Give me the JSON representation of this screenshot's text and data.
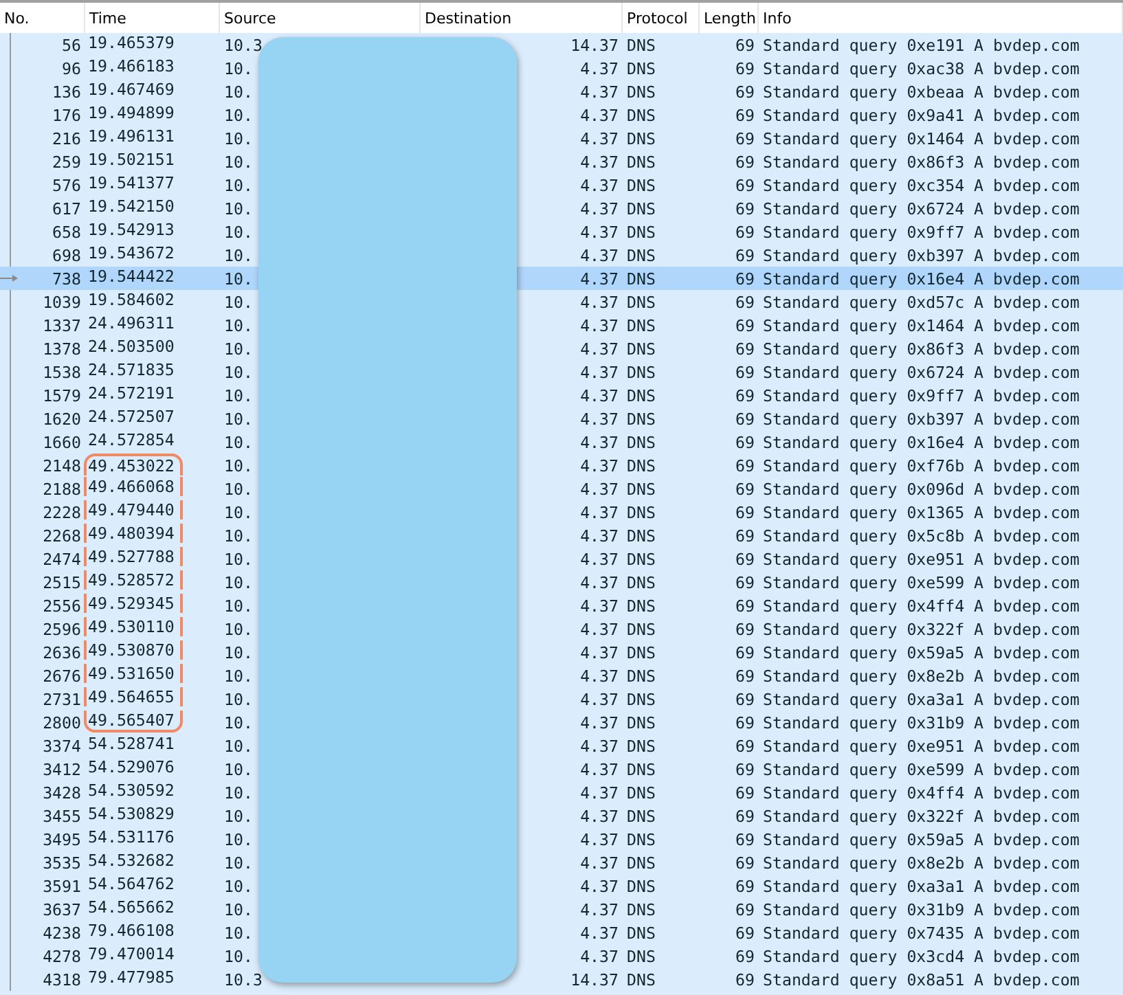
{
  "columns": [
    "No.",
    "Time",
    "Source",
    "Destination",
    "Protocol",
    "Length",
    "Info"
  ],
  "rows": [
    {
      "no": "56",
      "time": "19.465379",
      "source": "10.3",
      "destination": "14.37",
      "protocol": "DNS",
      "length": "69",
      "info": "Standard query 0xe191 A bvdep.com",
      "selected": false,
      "circled": false
    },
    {
      "no": "96",
      "time": "19.466183",
      "source": "10.",
      "destination": "4.37",
      "protocol": "DNS",
      "length": "69",
      "info": "Standard query 0xac38 A bvdep.com",
      "selected": false,
      "circled": false
    },
    {
      "no": "136",
      "time": "19.467469",
      "source": "10.",
      "destination": "4.37",
      "protocol": "DNS",
      "length": "69",
      "info": "Standard query 0xbeaa A bvdep.com",
      "selected": false,
      "circled": false
    },
    {
      "no": "176",
      "time": "19.494899",
      "source": "10.",
      "destination": "4.37",
      "protocol": "DNS",
      "length": "69",
      "info": "Standard query 0x9a41 A bvdep.com",
      "selected": false,
      "circled": false
    },
    {
      "no": "216",
      "time": "19.496131",
      "source": "10.",
      "destination": "4.37",
      "protocol": "DNS",
      "length": "69",
      "info": "Standard query 0x1464 A bvdep.com",
      "selected": false,
      "circled": false
    },
    {
      "no": "259",
      "time": "19.502151",
      "source": "10.",
      "destination": "4.37",
      "protocol": "DNS",
      "length": "69",
      "info": "Standard query 0x86f3 A bvdep.com",
      "selected": false,
      "circled": false
    },
    {
      "no": "576",
      "time": "19.541377",
      "source": "10.",
      "destination": "4.37",
      "protocol": "DNS",
      "length": "69",
      "info": "Standard query 0xc354 A bvdep.com",
      "selected": false,
      "circled": false
    },
    {
      "no": "617",
      "time": "19.542150",
      "source": "10.",
      "destination": "4.37",
      "protocol": "DNS",
      "length": "69",
      "info": "Standard query 0x6724 A bvdep.com",
      "selected": false,
      "circled": false
    },
    {
      "no": "658",
      "time": "19.542913",
      "source": "10.",
      "destination": "4.37",
      "protocol": "DNS",
      "length": "69",
      "info": "Standard query 0x9ff7 A bvdep.com",
      "selected": false,
      "circled": false
    },
    {
      "no": "698",
      "time": "19.543672",
      "source": "10.",
      "destination": "4.37",
      "protocol": "DNS",
      "length": "69",
      "info": "Standard query 0xb397 A bvdep.com",
      "selected": false,
      "circled": false
    },
    {
      "no": "738",
      "time": "19.544422",
      "source": "10.",
      "destination": "4.37",
      "protocol": "DNS",
      "length": "69",
      "info": "Standard query 0x16e4 A bvdep.com",
      "selected": true,
      "circled": false
    },
    {
      "no": "1039",
      "time": "19.584602",
      "source": "10.",
      "destination": "4.37",
      "protocol": "DNS",
      "length": "69",
      "info": "Standard query 0xd57c A bvdep.com",
      "selected": false,
      "circled": false
    },
    {
      "no": "1337",
      "time": "24.496311",
      "source": "10.",
      "destination": "4.37",
      "protocol": "DNS",
      "length": "69",
      "info": "Standard query 0x1464 A bvdep.com",
      "selected": false,
      "circled": false
    },
    {
      "no": "1378",
      "time": "24.503500",
      "source": "10.",
      "destination": "4.37",
      "protocol": "DNS",
      "length": "69",
      "info": "Standard query 0x86f3 A bvdep.com",
      "selected": false,
      "circled": false
    },
    {
      "no": "1538",
      "time": "24.571835",
      "source": "10.",
      "destination": "4.37",
      "protocol": "DNS",
      "length": "69",
      "info": "Standard query 0x6724 A bvdep.com",
      "selected": false,
      "circled": false
    },
    {
      "no": "1579",
      "time": "24.572191",
      "source": "10.",
      "destination": "4.37",
      "protocol": "DNS",
      "length": "69",
      "info": "Standard query 0x9ff7 A bvdep.com",
      "selected": false,
      "circled": false
    },
    {
      "no": "1620",
      "time": "24.572507",
      "source": "10.",
      "destination": "4.37",
      "protocol": "DNS",
      "length": "69",
      "info": "Standard query 0xb397 A bvdep.com",
      "selected": false,
      "circled": false
    },
    {
      "no": "1660",
      "time": "24.572854",
      "source": "10.",
      "destination": "4.37",
      "protocol": "DNS",
      "length": "69",
      "info": "Standard query 0x16e4 A bvdep.com",
      "selected": false,
      "circled": false
    },
    {
      "no": "2148",
      "time": "49.453022",
      "source": "10.",
      "destination": "4.37",
      "protocol": "DNS",
      "length": "69",
      "info": "Standard query 0xf76b A bvdep.com",
      "selected": false,
      "circled": true
    },
    {
      "no": "2188",
      "time": "49.466068",
      "source": "10.",
      "destination": "4.37",
      "protocol": "DNS",
      "length": "69",
      "info": "Standard query 0x096d A bvdep.com",
      "selected": false,
      "circled": true
    },
    {
      "no": "2228",
      "time": "49.479440",
      "source": "10.",
      "destination": "4.37",
      "protocol": "DNS",
      "length": "69",
      "info": "Standard query 0x1365 A bvdep.com",
      "selected": false,
      "circled": true
    },
    {
      "no": "2268",
      "time": "49.480394",
      "source": "10.",
      "destination": "4.37",
      "protocol": "DNS",
      "length": "69",
      "info": "Standard query 0x5c8b A bvdep.com",
      "selected": false,
      "circled": true
    },
    {
      "no": "2474",
      "time": "49.527788",
      "source": "10.",
      "destination": "4.37",
      "protocol": "DNS",
      "length": "69",
      "info": "Standard query 0xe951 A bvdep.com",
      "selected": false,
      "circled": true
    },
    {
      "no": "2515",
      "time": "49.528572",
      "source": "10.",
      "destination": "4.37",
      "protocol": "DNS",
      "length": "69",
      "info": "Standard query 0xe599 A bvdep.com",
      "selected": false,
      "circled": true
    },
    {
      "no": "2556",
      "time": "49.529345",
      "source": "10.",
      "destination": "4.37",
      "protocol": "DNS",
      "length": "69",
      "info": "Standard query 0x4ff4 A bvdep.com",
      "selected": false,
      "circled": true
    },
    {
      "no": "2596",
      "time": "49.530110",
      "source": "10.",
      "destination": "4.37",
      "protocol": "DNS",
      "length": "69",
      "info": "Standard query 0x322f A bvdep.com",
      "selected": false,
      "circled": true
    },
    {
      "no": "2636",
      "time": "49.530870",
      "source": "10.",
      "destination": "4.37",
      "protocol": "DNS",
      "length": "69",
      "info": "Standard query 0x59a5 A bvdep.com",
      "selected": false,
      "circled": true
    },
    {
      "no": "2676",
      "time": "49.531650",
      "source": "10.",
      "destination": "4.37",
      "protocol": "DNS",
      "length": "69",
      "info": "Standard query 0x8e2b A bvdep.com",
      "selected": false,
      "circled": true
    },
    {
      "no": "2731",
      "time": "49.564655",
      "source": "10.",
      "destination": "4.37",
      "protocol": "DNS",
      "length": "69",
      "info": "Standard query 0xa3a1 A bvdep.com",
      "selected": false,
      "circled": true
    },
    {
      "no": "2800",
      "time": "49.565407",
      "source": "10.",
      "destination": "4.37",
      "protocol": "DNS",
      "length": "69",
      "info": "Standard query 0x31b9 A bvdep.com",
      "selected": false,
      "circled": true
    },
    {
      "no": "3374",
      "time": "54.528741",
      "source": "10.",
      "destination": "4.37",
      "protocol": "DNS",
      "length": "69",
      "info": "Standard query 0xe951 A bvdep.com",
      "selected": false,
      "circled": false
    },
    {
      "no": "3412",
      "time": "54.529076",
      "source": "10.",
      "destination": "4.37",
      "protocol": "DNS",
      "length": "69",
      "info": "Standard query 0xe599 A bvdep.com",
      "selected": false,
      "circled": false
    },
    {
      "no": "3428",
      "time": "54.530592",
      "source": "10.",
      "destination": "4.37",
      "protocol": "DNS",
      "length": "69",
      "info": "Standard query 0x4ff4 A bvdep.com",
      "selected": false,
      "circled": false
    },
    {
      "no": "3455",
      "time": "54.530829",
      "source": "10.",
      "destination": "4.37",
      "protocol": "DNS",
      "length": "69",
      "info": "Standard query 0x322f A bvdep.com",
      "selected": false,
      "circled": false
    },
    {
      "no": "3495",
      "time": "54.531176",
      "source": "10.",
      "destination": "4.37",
      "protocol": "DNS",
      "length": "69",
      "info": "Standard query 0x59a5 A bvdep.com",
      "selected": false,
      "circled": false
    },
    {
      "no": "3535",
      "time": "54.532682",
      "source": "10.",
      "destination": "4.37",
      "protocol": "DNS",
      "length": "69",
      "info": "Standard query 0x8e2b A bvdep.com",
      "selected": false,
      "circled": false
    },
    {
      "no": "3591",
      "time": "54.564762",
      "source": "10.",
      "destination": "4.37",
      "protocol": "DNS",
      "length": "69",
      "info": "Standard query 0xa3a1 A bvdep.com",
      "selected": false,
      "circled": false
    },
    {
      "no": "3637",
      "time": "54.565662",
      "source": "10.",
      "destination": "4.37",
      "protocol": "DNS",
      "length": "69",
      "info": "Standard query 0x31b9 A bvdep.com",
      "selected": false,
      "circled": false
    },
    {
      "no": "4238",
      "time": "79.466108",
      "source": "10.",
      "destination": "4.37",
      "protocol": "DNS",
      "length": "69",
      "info": "Standard query 0x7435 A bvdep.com",
      "selected": false,
      "circled": false
    },
    {
      "no": "4278",
      "time": "79.470014",
      "source": "10.",
      "destination": "4.37",
      "protocol": "DNS",
      "length": "69",
      "info": "Standard query 0x3cd4 A bvdep.com",
      "selected": false,
      "circled": false
    },
    {
      "no": "4318",
      "time": "79.477985",
      "source": "10.3",
      "destination": "14.37",
      "protocol": "DNS",
      "length": "69",
      "info": "Standard query 0x8a51 A bvdep.com",
      "selected": false,
      "circled": false
    }
  ]
}
